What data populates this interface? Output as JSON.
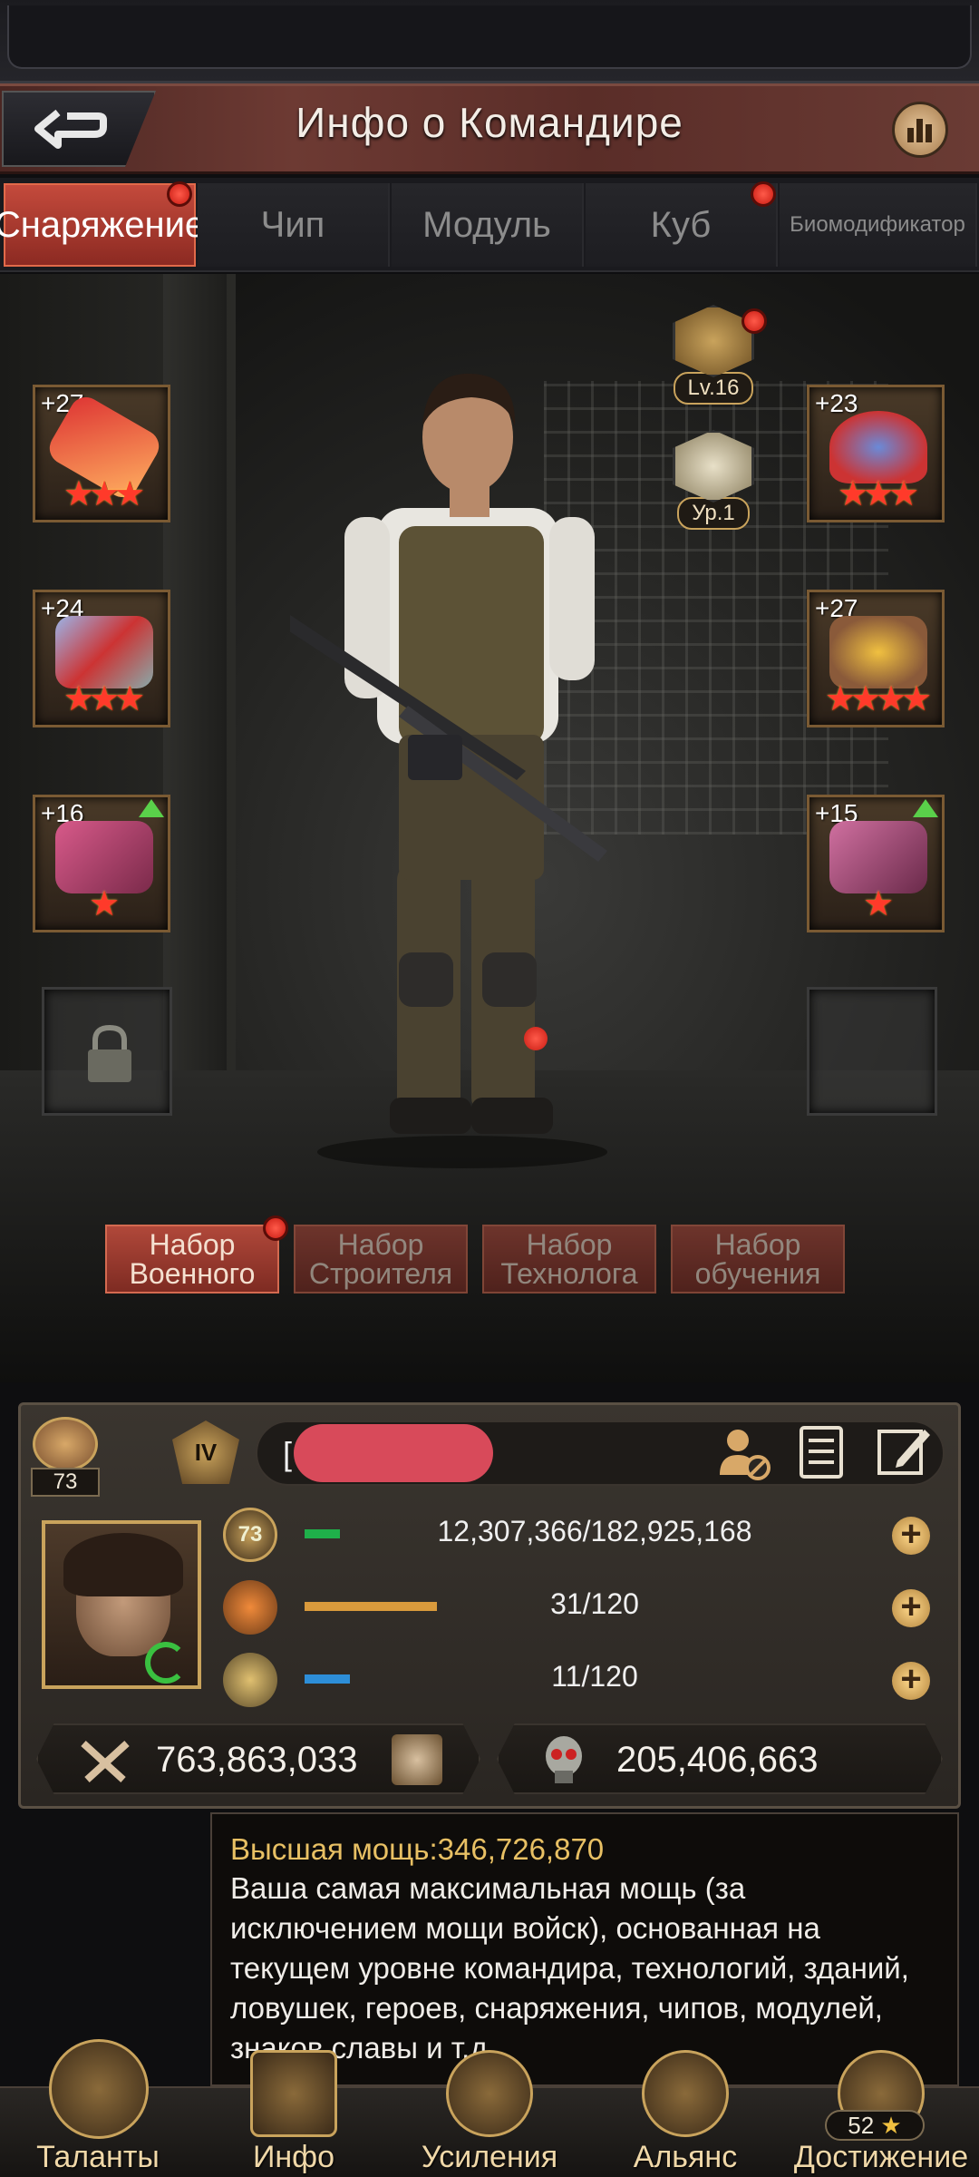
{
  "header": {
    "title": "Инфо о Командире"
  },
  "tabs": [
    {
      "label": "Снаряжение",
      "active": true,
      "badge": true
    },
    {
      "label": "Чип"
    },
    {
      "label": "Модуль"
    },
    {
      "label": "Куб",
      "badge": true
    },
    {
      "label": "Биомодификатор"
    }
  ],
  "commander_level": "Lv.16",
  "rank_level": "Ур.1",
  "equipment": {
    "left": [
      {
        "level": "+27",
        "stars": "★★★",
        "item": "weapon"
      },
      {
        "level": "+24",
        "stars": "★★★",
        "item": "chest-plate"
      },
      {
        "level": "+16",
        "stars": "★",
        "item": "armor",
        "upgrade": true
      }
    ],
    "right": [
      {
        "level": "+23",
        "stars": "★★★",
        "item": "helmet"
      },
      {
        "level": "+27",
        "stars": "★★★★",
        "item": "gloves"
      },
      {
        "level": "+15",
        "stars": "★",
        "item": "boots",
        "upgrade": true
      }
    ]
  },
  "sets": [
    {
      "label": "Набор Военного",
      "active": true,
      "badge": true
    },
    {
      "label": "Набор Строителя"
    },
    {
      "label": "Набор Технолога"
    },
    {
      "label": "Набор обучения"
    }
  ],
  "profile": {
    "like_count": "73",
    "vip_level": "IV",
    "name_prefix": "[",
    "level": "73",
    "exp": {
      "text": "12,307,366/182,925,168",
      "fill": 0.07,
      "color": "#1fb04a"
    },
    "stamina": {
      "text": "31/120",
      "fill": 0.26,
      "color": "#d99a3c"
    },
    "energy": {
      "text": "11/120",
      "fill": 0.09,
      "color": "#2d8ed8"
    },
    "power": "763,863,033",
    "kills": "205,406,663"
  },
  "tooltip": {
    "title": "Высшая мощь:346,726,870",
    "body": "Ваша самая максимальная мощь (за исключением мощи войск), основанная на текущем уровне командира, технологий, зданий, ловушек, героев, снаряжения, чипов, модулей, знаков славы и т.д."
  },
  "nav": [
    {
      "label": "Таланты"
    },
    {
      "label": "Инфо"
    },
    {
      "label": "Усиления"
    },
    {
      "label": "Альянс"
    },
    {
      "label": "Достижение",
      "count": "52"
    }
  ]
}
